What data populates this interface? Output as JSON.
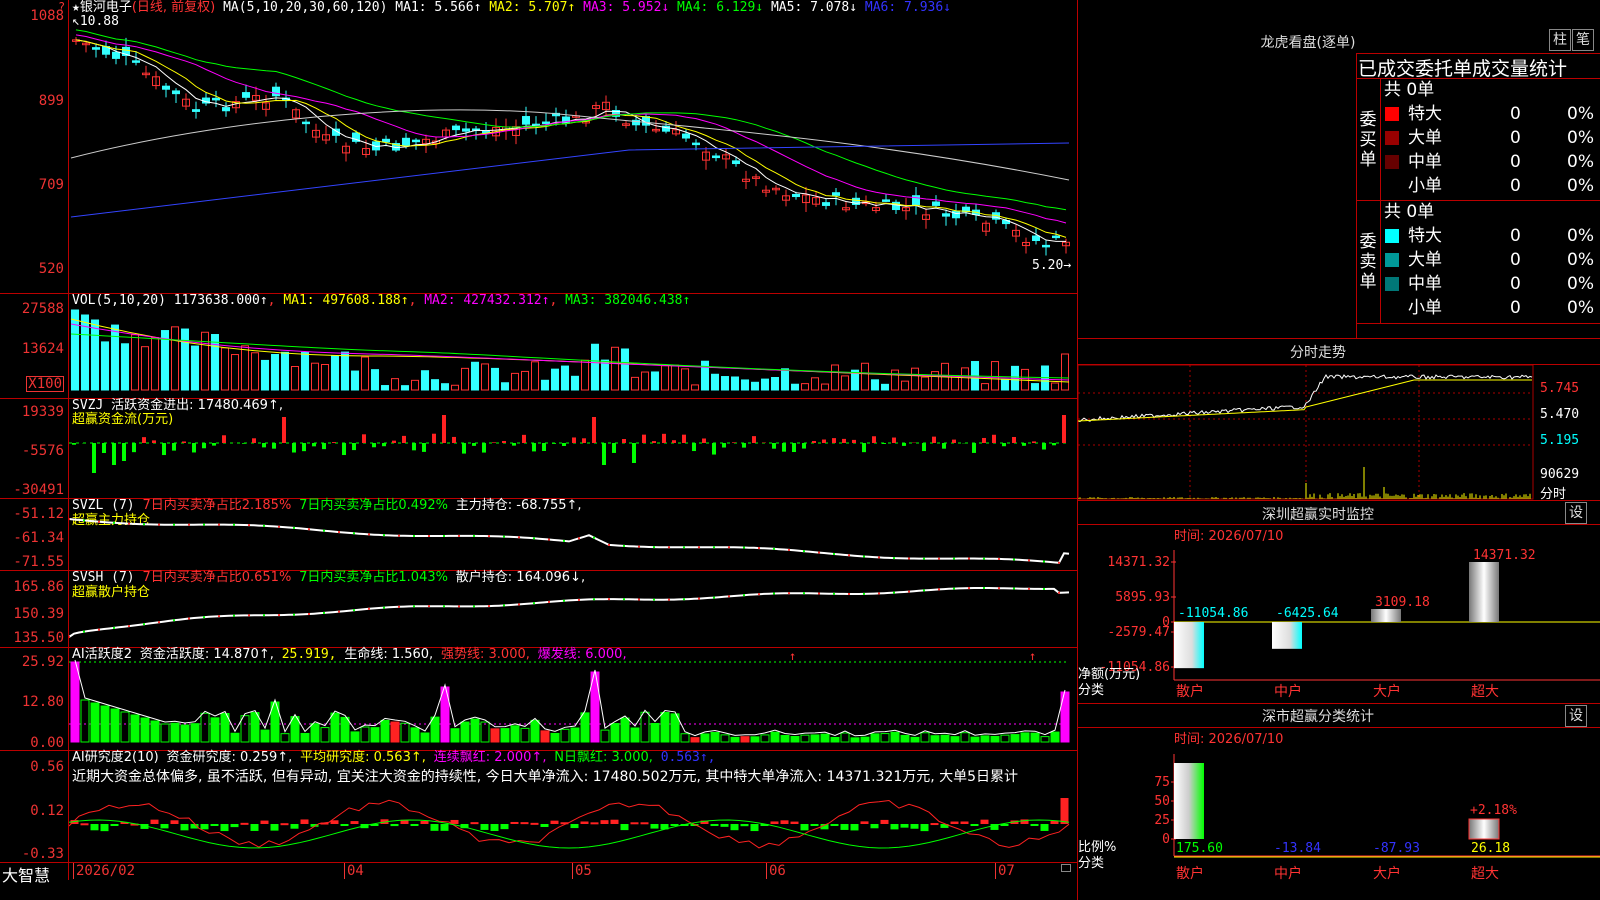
{
  "chart_data": {
    "type": "candlestick",
    "stock_name": "银河电子",
    "period_label": "(日线, 前复权)",
    "ma_params": "MA(5,10,20,30,60,120)",
    "ma_values": [
      {
        "label": "MA1: 5.566↑",
        "color": "#ffffff"
      },
      {
        "label": "MA2: 5.707↑",
        "color": "#ffff00"
      },
      {
        "label": "MA3: 5.952↓",
        "color": "#ff00ff"
      },
      {
        "label": "MA4: 6.129↓",
        "color": "#00ff00"
      },
      {
        "label": "MA5: 7.078↓",
        "color": "#ffffff"
      },
      {
        "label": "MA6: 7.936↓",
        "color": "#3333ff"
      }
    ],
    "price_high_label": "10.88",
    "price_low_label": "5.20",
    "price_yticks": [
      "1088",
      "899",
      "709",
      "520"
    ],
    "volume": {
      "label": "VOL(5,10,20)",
      "value": "1173638.000↑",
      "ma1": "MA1: 497608.188↑",
      "ma2": "MA2: 427432.312↑",
      "ma3": "MA3: 382046.438↑",
      "yticks": [
        "27588",
        "13624"
      ],
      "unit": "X100"
    },
    "svzj": {
      "label": "SVZJ",
      "text": "活跃资金进出: 17480.469↑,",
      "subtitle": "超赢资金流(万元)",
      "yticks": [
        "19339",
        "-5576",
        "-30491"
      ]
    },
    "svzl": {
      "label": "SVZL (7)",
      "t1": "7日内买卖净占比2.185%",
      "t2": "7日内买卖净占比0.492%",
      "t3": "主力持仓: -68.755↑,",
      "subtitle": "超赢主力持仓",
      "yticks": [
        "-51.12",
        "-61.34",
        "-71.55"
      ]
    },
    "svsh": {
      "label": "SVSH (7)",
      "t1": "7日内买卖净占比0.651%",
      "t2": "7日内买卖净占比1.043%",
      "t3": "散户持仓: 164.096↓,",
      "subtitle": "超赢散户持仓",
      "yticks": [
        "165.86",
        "150.39",
        "135.50"
      ]
    },
    "ai_active": {
      "label": "AI活跃度2",
      "t1": "资金活跃度: 14.870↑,",
      "t2": "25.919,",
      "t3": "生命线: 1.560,",
      "t4": "强势线: 3.000,",
      "t5": "爆发线: 6.000,",
      "yticks": [
        "25.92",
        "12.80",
        "0.00"
      ]
    },
    "ai_research": {
      "label": "AI研究度2(10)",
      "t1": "资金研究度: 0.259↑,",
      "t2": "平均研究度: 0.563↑,",
      "t3": "连续飘红: 2.000↑,",
      "t4": "N日飘红: 3.000,",
      "t5": "0.563↑,",
      "comment": "近期大资金总体偏多, 虽不活跃, 但有异动, 宜关注大资金的持续性, 今日大单净流入: 17480.502万元, 其中特大单净流入: 14371.321万元, 大单5日累计",
      "yticks": [
        "0.56",
        "0.12",
        "-0.33"
      ]
    },
    "x_dates": [
      "2026/02",
      "04",
      "05",
      "06",
      "07"
    ]
  },
  "app": {
    "brand": "大智慧"
  },
  "lhb": {
    "title": "龙虎看盘(逐单)",
    "btn_zhu": "柱",
    "btn_bi": "笔",
    "header": "已成交委托单成交量统计",
    "buy": {
      "side_label": "委买单",
      "count_label": "共 0单",
      "rows": [
        {
          "name": "特大",
          "num": "0",
          "pct": "0%",
          "color": "#ff0000"
        },
        {
          "name": "大单",
          "num": "0",
          "pct": "0%",
          "color": "#990000"
        },
        {
          "name": "中单",
          "num": "0",
          "pct": "0%",
          "color": "#660000"
        },
        {
          "name": "小单",
          "num": "0",
          "pct": "0%",
          "color": ""
        }
      ]
    },
    "sell": {
      "side_label": "委卖单",
      "count_label": "共 0单",
      "rows": [
        {
          "name": "特大",
          "num": "0",
          "pct": "0%",
          "color": "#00ffff"
        },
        {
          "name": "大单",
          "num": "0",
          "pct": "0%",
          "color": "#009999"
        },
        {
          "name": "中单",
          "num": "0",
          "pct": "0%",
          "color": "#007777"
        },
        {
          "name": "小单",
          "num": "0",
          "pct": "0%",
          "color": ""
        }
      ]
    }
  },
  "intraday": {
    "title": "分时走势",
    "yticks": [
      "5.745",
      "5.470",
      "5.195"
    ],
    "vol_label": "90629",
    "vol_unit": "分时"
  },
  "sz_monitor": {
    "title": "深圳超赢实时监控",
    "btn": "设",
    "time_label": "时间: 2026/07/10",
    "yticks": [
      "14371.32",
      "5895.93",
      "0",
      "-2579.47",
      "-11054.86"
    ],
    "left_label1": "净额(万元)",
    "left_label2": "分类",
    "categories": [
      "散户",
      "中户",
      "大户",
      "超大"
    ],
    "values": [
      -11054.86,
      -6425.64,
      3109.18,
      14371.32
    ],
    "value_labels": [
      "-11054.86",
      "-6425.64",
      "3109.18",
      "14371.32"
    ]
  },
  "sz_class": {
    "title": "深市超赢分类统计",
    "btn": "设",
    "time_label": "时间: 2026/07/10",
    "yticks": [
      "75",
      "50",
      "25",
      "0"
    ],
    "left_label1": "比例%",
    "left_label2": "分类",
    "categories": [
      "散户",
      "中户",
      "大户",
      "超大"
    ],
    "values": [
      "175.60",
      "-13.84",
      "-87.93",
      "26.18"
    ],
    "bar_heights": [
      100,
      0,
      0,
      26.18
    ],
    "top_label": "+2.18%"
  }
}
